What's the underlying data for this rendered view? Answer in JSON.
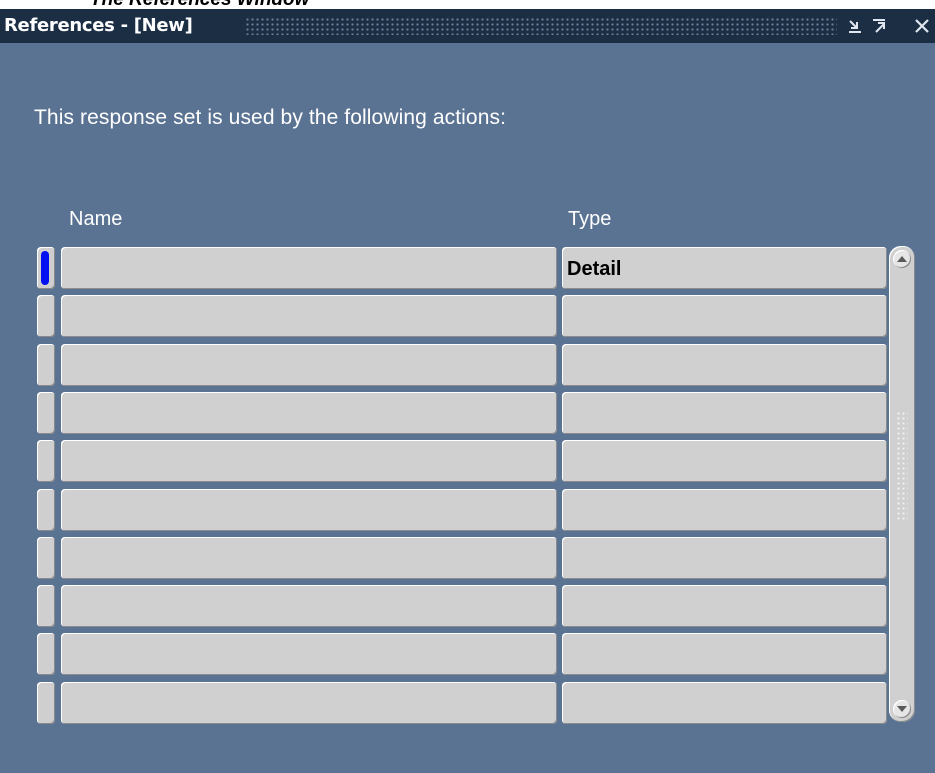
{
  "page_caption": "The References Window",
  "window": {
    "title": "References - [New]",
    "buttons": {
      "minimize_icon": "minimize-icon",
      "maximize_icon": "maximize-icon",
      "close_icon": "close-icon"
    }
  },
  "prompt": "This response set is used by the following actions:",
  "table": {
    "headers": {
      "name": "Name",
      "type": "Type"
    },
    "rows": [
      {
        "name": "",
        "type": "Detail"
      },
      {
        "name": "",
        "type": ""
      },
      {
        "name": "",
        "type": ""
      },
      {
        "name": "",
        "type": ""
      },
      {
        "name": "",
        "type": ""
      },
      {
        "name": "",
        "type": ""
      },
      {
        "name": "",
        "type": ""
      },
      {
        "name": "",
        "type": ""
      },
      {
        "name": "",
        "type": ""
      },
      {
        "name": "",
        "type": ""
      }
    ],
    "active_row": 0
  },
  "colors": {
    "window_bg": "#5b7393",
    "titlebar_bg": "#1c2e44",
    "cell_bg": "#d0d0d0",
    "active_marker": "#0010f0"
  }
}
